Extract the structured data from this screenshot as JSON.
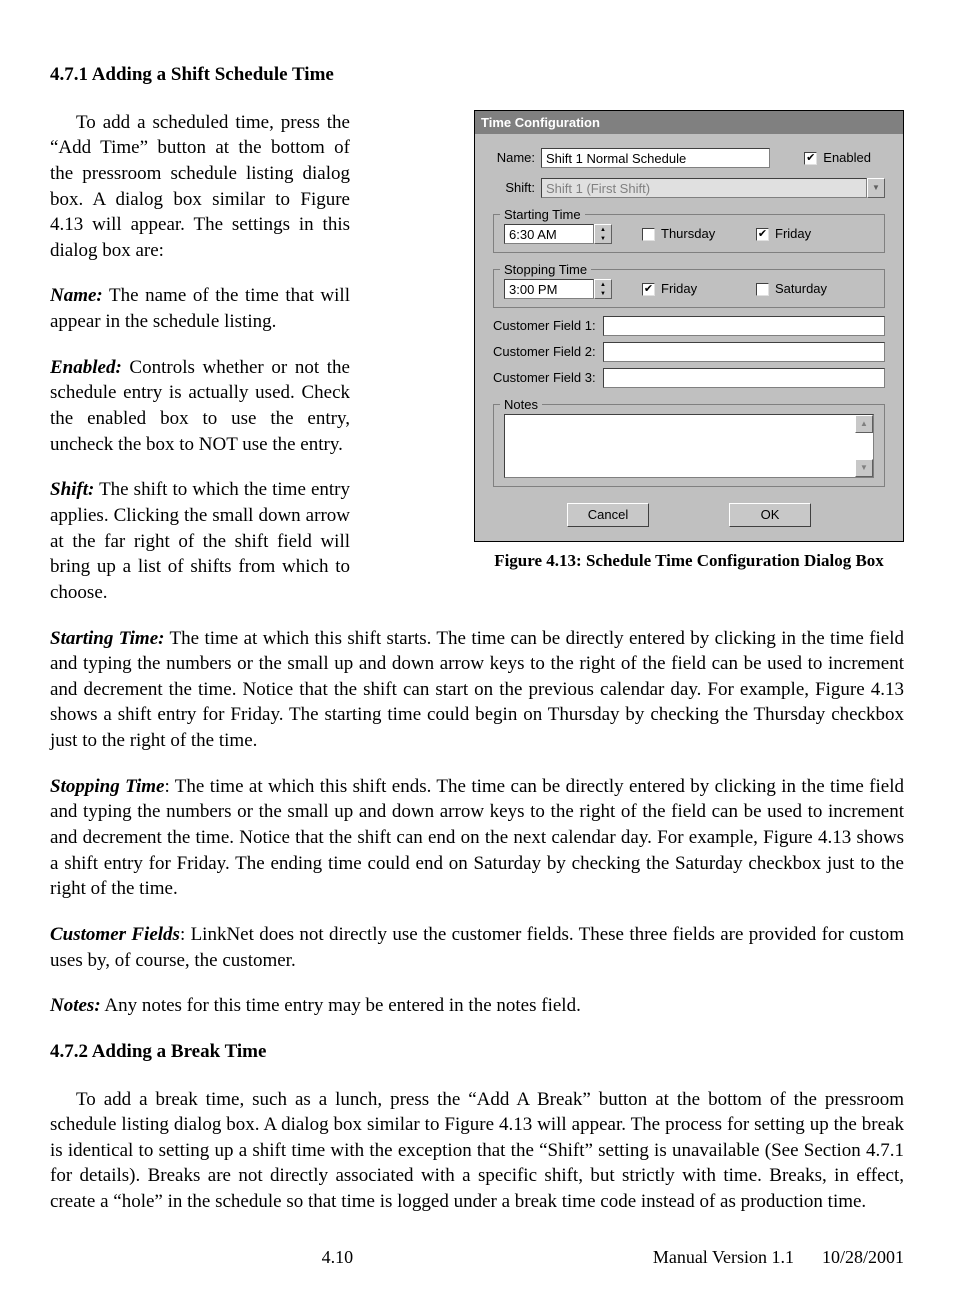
{
  "headings": {
    "s1": "4.7.1   Adding a Shift Schedule Time",
    "s2": "4.7.2   Adding a Break Time"
  },
  "intro": "To add a scheduled time, press the “Add Time” button at the bottom of the pressroom schedule listing dialog box.  A dialog box similar to Figure 4.13 will appear.  The settings in this dialog box are:",
  "defs": {
    "name_l": "Name:",
    "name_t": "  The name of the time that will appear in the schedule listing.",
    "enabled_l": "Enabled:",
    "enabled_t": "  Controls whether or not the schedule entry is actually used.  Check the enabled box to use the entry, uncheck the box to NOT use the entry.",
    "shift_l": "Shift:",
    "shift_t": "  The shift to which the time entry applies.  Clicking the small down arrow at the far right of the shift field will bring up a list of shifts from which to choose.",
    "start_l": "Starting Time:",
    "start_t": "  The time at which this shift starts.  The time can be directly entered by clicking in the time field and typing the numbers or the small up and down arrow keys to the right of the field can be used to increment and decrement the time.  Notice that the shift can start on the previous calendar day.  For example, Figure 4.13 shows a shift entry for Friday.  The starting time could begin on Thursday by checking the Thursday checkbox just to the right of the time.",
    "stop_l": "Stopping Time",
    "stop_t": ":  The time at which this shift ends.  The time can be directly entered by clicking in the time field and typing the numbers or the small up and down arrow keys to the right of the field can be used to increment and decrement the time.  Notice that the shift can end on the next calendar day.  For example, Figure 4.13 shows a shift entry for Friday.  The ending time could end on Saturday by checking the Saturday checkbox just to the right of the time.",
    "cust_l": "Customer Fields",
    "cust_t": ":  LinkNet does not directly use the customer fields.  These three fields are provided for custom uses by, of course, the customer.",
    "notes_l": "Notes:",
    "notes_t": "  Any notes for this time entry may be entered in the notes field."
  },
  "breakp": "To add a break time, such as a lunch, press the “Add A Break” button at the bottom of the pressroom schedule listing dialog box.  A dialog box similar to Figure 4.13 will appear.  The process for setting up the break is identical to setting up a shift time with the exception that the “Shift” setting is unavailable (See Section 4.7.1 for details).  Breaks are not directly associated with a specific shift, but strictly with time.  Breaks, in effect, create a “hole” in the schedule so that time is logged under a break time code instead of as production time.",
  "caption": "Figure 4.13: Schedule Time Configuration Dialog Box",
  "dlg": {
    "title": "Time Configuration",
    "name_l": "Name:",
    "name_v": "Shift 1 Normal Schedule",
    "enabled_l": "Enabled",
    "shift_l": "Shift:",
    "shift_v": "Shift 1 (First Shift)",
    "start_grp": "Starting Time",
    "start_v": "6:30 AM",
    "start_d1": "Thursday",
    "start_d2": "Friday",
    "stop_grp": "Stopping Time",
    "stop_v": "3:00 PM",
    "stop_d1": "Friday",
    "stop_d2": "Saturday",
    "cf1": "Customer Field 1:",
    "cf2": "Customer Field 2:",
    "cf3": "Customer Field 3:",
    "notes_grp": "Notes",
    "cancel": "Cancel",
    "ok": "OK"
  },
  "footer": {
    "page": "4.10",
    "ver": "Manual Version 1.1",
    "date": "10/28/2001"
  }
}
